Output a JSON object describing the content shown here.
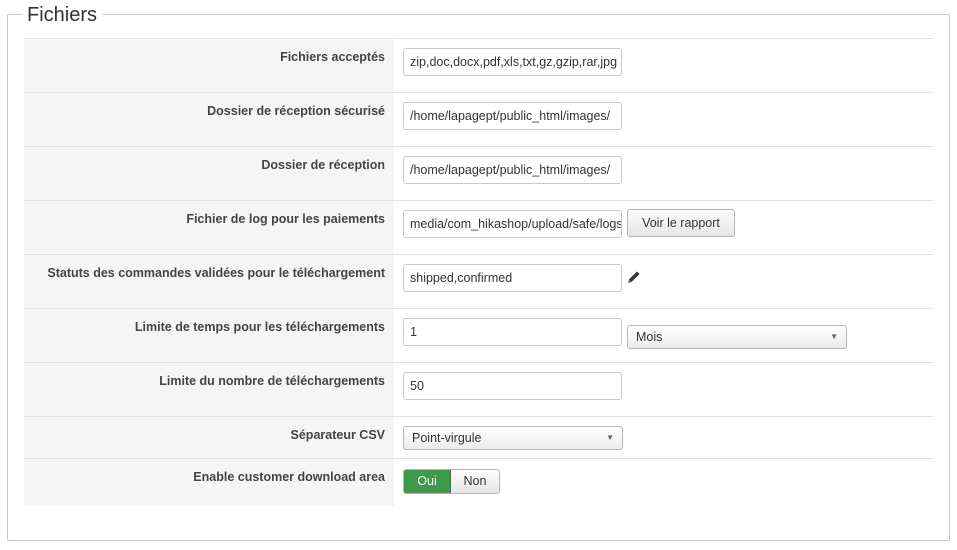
{
  "section": {
    "title": "Fichiers"
  },
  "fields": {
    "accepted_files": {
      "label": "Fichiers acceptés",
      "value": "zip,doc,docx,pdf,xls,txt,gz,gzip,rar,jpg"
    },
    "secure_folder": {
      "label": "Dossier de réception sécurisé",
      "value": "/home/lapagept/public_html/images/"
    },
    "upload_folder": {
      "label": "Dossier de réception",
      "value": "/home/lapagept/public_html/images/"
    },
    "payment_log": {
      "label": "Fichier de log pour les paiements",
      "value": "media/com_hikashop/upload/safe/logs/",
      "button": "Voir le rapport"
    },
    "order_statuses": {
      "label": "Statuts des commandes validées pour le téléchargement",
      "value": "shipped,confirmed",
      "icon": "pencil-icon"
    },
    "time_limit": {
      "label": "Limite de temps pour les téléchargements",
      "value": "1",
      "unit": "Mois"
    },
    "download_limit": {
      "label": "Limite du nombre de téléchargements",
      "value": "50"
    },
    "csv_separator": {
      "label": "Séparateur CSV",
      "value": "Point-virgule"
    },
    "customer_area": {
      "label": "Enable customer download area",
      "yes": "Oui",
      "no": "Non",
      "selected": "Oui"
    }
  },
  "colors": {
    "toggle_active": "#3d9a4a",
    "label_bg": "#f5f5f5"
  }
}
